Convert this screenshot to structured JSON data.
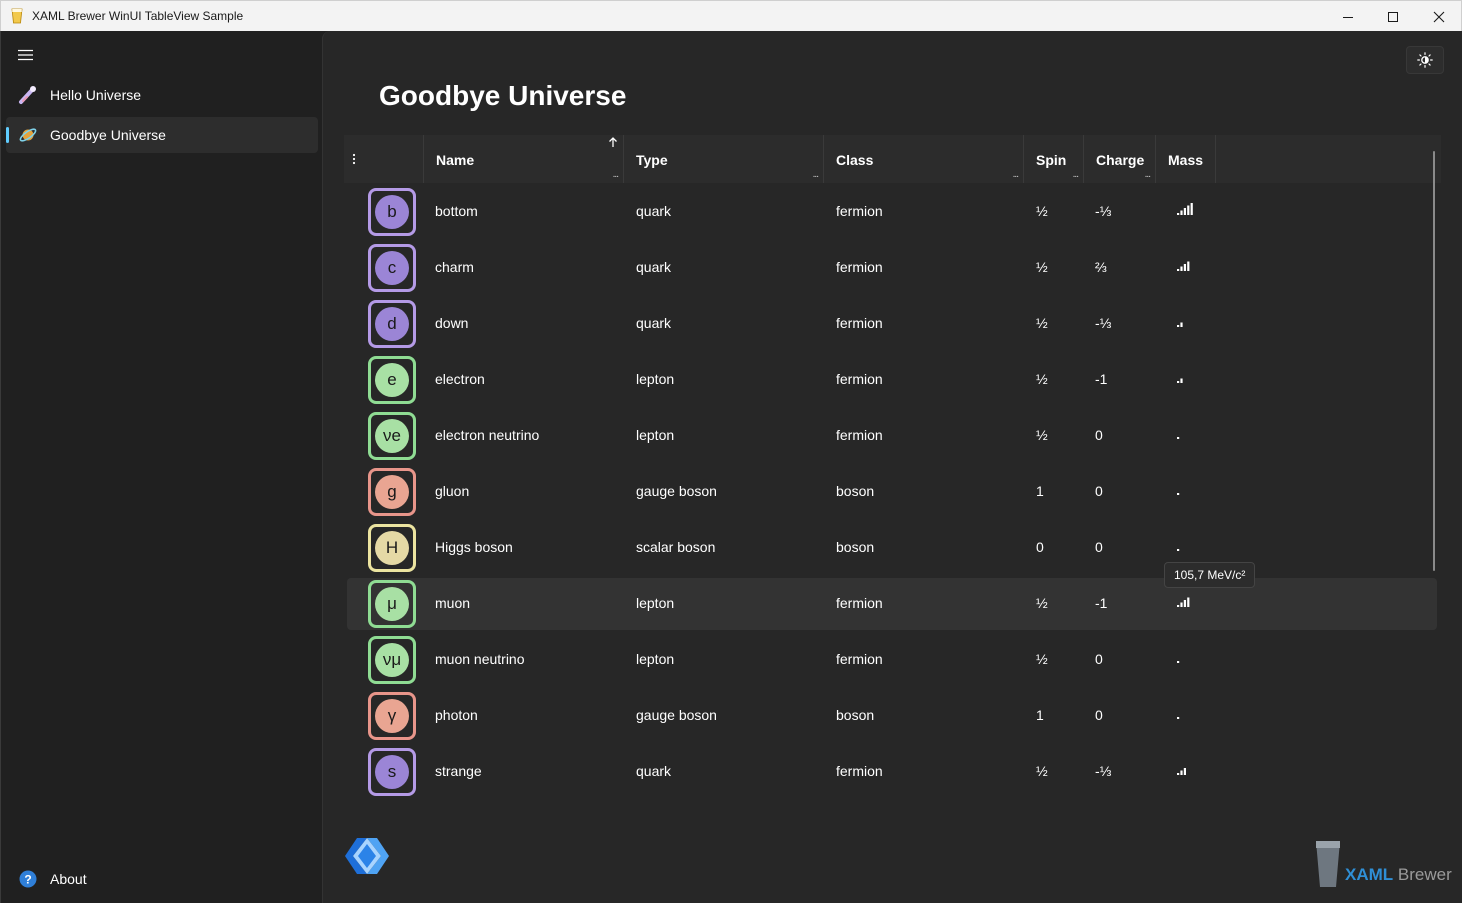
{
  "window": {
    "title": "XAML Brewer WinUI TableView Sample",
    "minimize_icon": "minimize-icon",
    "maximize_icon": "maximize-icon",
    "close_icon": "close-icon"
  },
  "sidebar": {
    "items": [
      {
        "label": "Hello Universe",
        "icon": "comet-icon",
        "selected": false
      },
      {
        "label": "Goodbye Universe",
        "icon": "planet-icon",
        "selected": true
      }
    ],
    "footer": {
      "label": "About",
      "icon": "help-icon"
    }
  },
  "page": {
    "title": "Goodbye Universe"
  },
  "table": {
    "columns": [
      "Name",
      "Type",
      "Class",
      "Spin",
      "Charge",
      "Mass"
    ],
    "column_menu_glyph": "...",
    "sorted_column": "Name",
    "sort_direction": "ascending",
    "rows": [
      {
        "symbol": "b",
        "name": "bottom",
        "type": "quark",
        "class": "fermion",
        "spin": "½",
        "charge": "-⅓",
        "mass_level": 5,
        "color": "quark"
      },
      {
        "symbol": "c",
        "name": "charm",
        "type": "quark",
        "class": "fermion",
        "spin": "½",
        "charge": "⅔",
        "mass_level": 4,
        "color": "quark"
      },
      {
        "symbol": "d",
        "name": "down",
        "type": "quark",
        "class": "fermion",
        "spin": "½",
        "charge": "-⅓",
        "mass_level": 2,
        "color": "quark"
      },
      {
        "symbol": "e",
        "name": "electron",
        "type": "lepton",
        "class": "fermion",
        "spin": "½",
        "charge": "-1",
        "mass_level": 2,
        "color": "lepton"
      },
      {
        "symbol": "νe",
        "name": "electron neutrino",
        "type": "lepton",
        "class": "fermion",
        "spin": "½",
        "charge": "0",
        "mass_level": 1,
        "color": "lepton"
      },
      {
        "symbol": "g",
        "name": "gluon",
        "type": "gauge boson",
        "class": "boson",
        "spin": "1",
        "charge": "0",
        "mass_level": 1,
        "color": "gauge"
      },
      {
        "symbol": "H",
        "name": "Higgs boson",
        "type": "scalar boson",
        "class": "boson",
        "spin": "0",
        "charge": "0",
        "mass_level": 1,
        "color": "scalar"
      },
      {
        "symbol": "μ",
        "name": "muon",
        "type": "lepton",
        "class": "fermion",
        "spin": "½",
        "charge": "-1",
        "mass_level": 4,
        "color": "lepton",
        "hover": true
      },
      {
        "symbol": "νμ",
        "name": "muon neutrino",
        "type": "lepton",
        "class": "fermion",
        "spin": "½",
        "charge": "0",
        "mass_level": 1,
        "color": "lepton"
      },
      {
        "symbol": "γ",
        "name": "photon",
        "type": "gauge boson",
        "class": "boson",
        "spin": "1",
        "charge": "0",
        "mass_level": 1,
        "color": "gauge"
      },
      {
        "symbol": "s",
        "name": "strange",
        "type": "quark",
        "class": "fermion",
        "spin": "½",
        "charge": "-⅓",
        "mass_level": 3,
        "color": "quark"
      }
    ]
  },
  "tooltip": {
    "text": "105,7 MeV/c²"
  },
  "colors": {
    "quark": {
      "border": "#b49ae6",
      "fill": "#9b85d6"
    },
    "lepton": {
      "border": "#8fdc93",
      "fill": "#a8e0a4"
    },
    "gauge": {
      "border": "#e8958a",
      "fill": "#e9a592"
    },
    "scalar": {
      "border": "#ece4a0",
      "fill": "#e5d9a5"
    },
    "accent": "#60cdff"
  },
  "branding": {
    "name_part1": "XAML",
    "name_part2": "Brewer",
    "logo_icon": "winui-logo-icon"
  },
  "theme_toggle_icon": "sun-icon"
}
